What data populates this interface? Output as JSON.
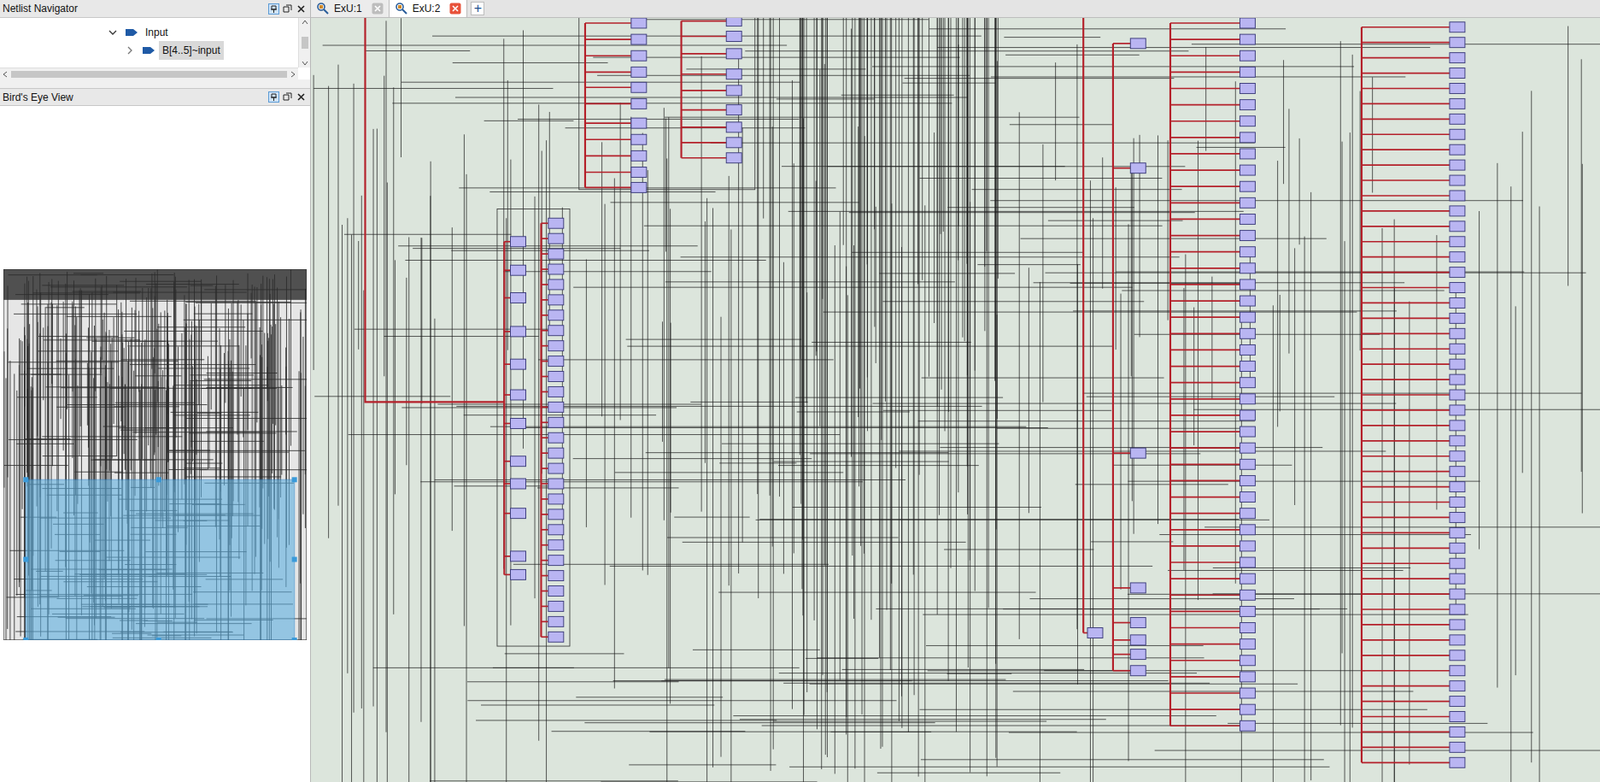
{
  "panels": {
    "netlist_navigator": {
      "title": "Netlist Navigator",
      "tree": [
        {
          "label": "Input",
          "expanded": true,
          "selected": false,
          "kind": "group"
        },
        {
          "label": "B[4..5]~input",
          "expanded": false,
          "selected": true,
          "kind": "item"
        }
      ]
    },
    "birds_eye": {
      "title": "Bird's Eye View"
    }
  },
  "tabs": [
    {
      "label": "ExU:1",
      "selected": false
    },
    {
      "label": "ExU:2",
      "selected": true
    }
  ],
  "new_tab": "+"
}
